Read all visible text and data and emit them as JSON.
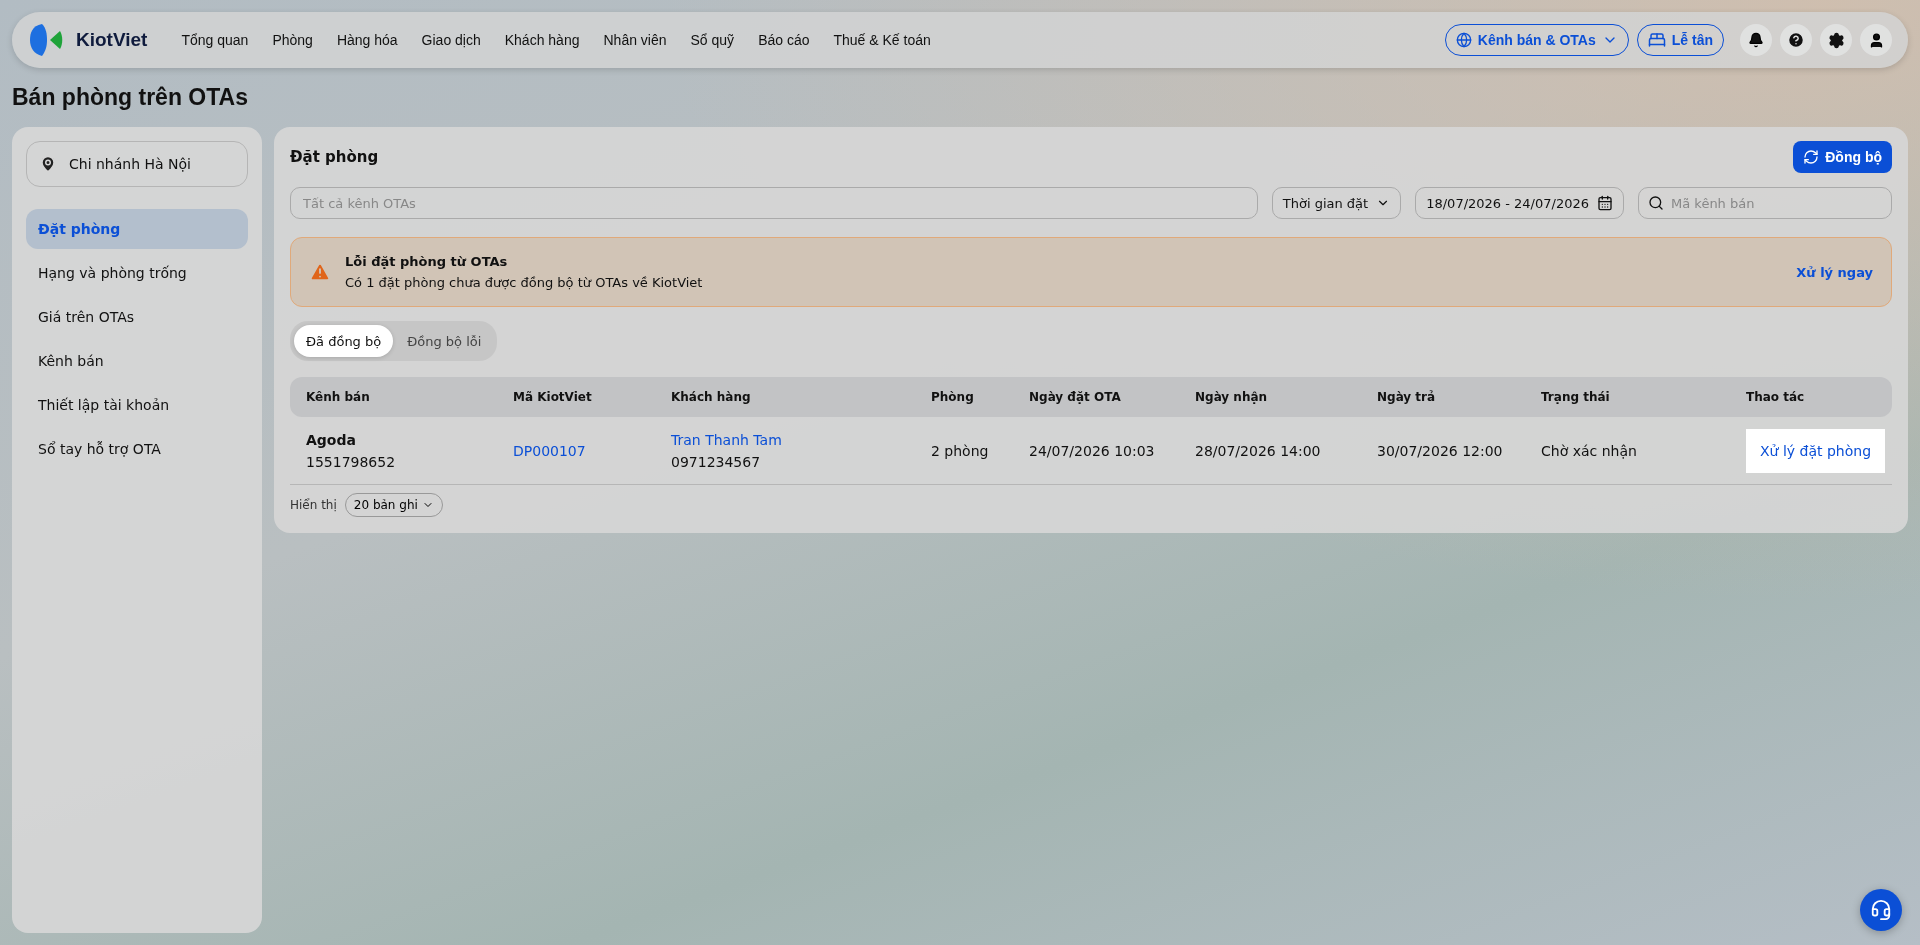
{
  "nav": {
    "logo_text": "KiotViet",
    "menu": [
      {
        "label": "Tổng quan",
        "selected": false
      },
      {
        "label": "Phòng",
        "selected": false
      },
      {
        "label": "Hàng hóa",
        "selected": false
      },
      {
        "label": "Giao dịch",
        "selected": false
      },
      {
        "label": "Khách hàng",
        "selected": false
      },
      {
        "label": "Nhân viên",
        "selected": false
      },
      {
        "label": "Sổ quỹ",
        "selected": false
      },
      {
        "label": "Báo cáo",
        "selected": false
      },
      {
        "label": "Thuế & Kế toán",
        "selected": false
      }
    ],
    "channels_button": "Kênh bán & OTAs",
    "front_desk_button": "Lễ tân"
  },
  "page_title": "Bán phòng trên OTAs",
  "sidebar": {
    "branch": "Chi nhánh Hà Nội",
    "items": [
      {
        "label": "Đặt phòng",
        "selected": true
      },
      {
        "label": "Hạng và phòng trống",
        "selected": false
      },
      {
        "label": "Giá trên OTAs",
        "selected": false
      },
      {
        "label": "Kênh bán",
        "selected": false
      },
      {
        "label": "Thiết lập tài khoản",
        "selected": false
      },
      {
        "label": "Sổ tay hỗ trợ OTA",
        "selected": false
      }
    ]
  },
  "panel": {
    "title": "Đặt phòng",
    "sync_button": "Đồng bộ",
    "filters": {
      "channel_placeholder": "Tất cả kênh OTAs",
      "time_filter": "Thời gian đặt",
      "date_range": "18/07/2026 - 24/07/2026",
      "search_placeholder": "Mã kênh bán"
    },
    "alert": {
      "title": "Lỗi đặt phòng từ OTAs",
      "message": "Có 1 đặt phòng chưa được đồng bộ từ OTAs về KiotViet",
      "action": "Xử lý ngay"
    },
    "tabs": [
      {
        "label": "Đã đồng bộ",
        "selected": true
      },
      {
        "label": "Đồng bộ lỗi",
        "selected": false
      }
    ],
    "table": {
      "columns": [
        "Kênh bán",
        "Mã KiotViet",
        "Khách hàng",
        "Phòng",
        "Ngày đặt OTA",
        "Ngày nhận",
        "Ngày trả",
        "Trạng thái",
        "Thao tác"
      ],
      "rows": [
        {
          "channel": "Agoda",
          "channel_code": "1551798652",
          "code": "DP000107",
          "guest": "Tran Thanh Tam",
          "phone": "0971234567",
          "rooms": "2 phòng",
          "booked": "24/07/2026 10:03",
          "check_in": "28/07/2026 14:00",
          "check_out": "30/07/2026 12:00",
          "status": "Chờ xác nhận",
          "action": "Xử lý đặt phòng"
        }
      ]
    },
    "footer": {
      "label": "Hiển thị",
      "page_size": "20 bản ghi"
    }
  }
}
